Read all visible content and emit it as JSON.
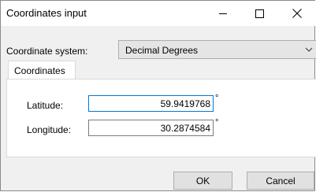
{
  "window": {
    "title": "Coordinates input"
  },
  "coordinate_system": {
    "label": "Coordinate system:",
    "selected": "Decimal Degrees"
  },
  "tabs": [
    {
      "label": "Coordinates"
    }
  ],
  "fields": {
    "latitude": {
      "label": "Latitude:",
      "value": "59.9419768",
      "unit": "°"
    },
    "longitude": {
      "label": "Longitude:",
      "value": "30.2874584",
      "unit": "°"
    }
  },
  "buttons": {
    "ok": "OK",
    "cancel": "Cancel"
  },
  "icons": {
    "minimize": "minimize-icon",
    "maximize": "maximize-icon",
    "close": "close-icon",
    "dropdown": "chevron-down-icon"
  }
}
